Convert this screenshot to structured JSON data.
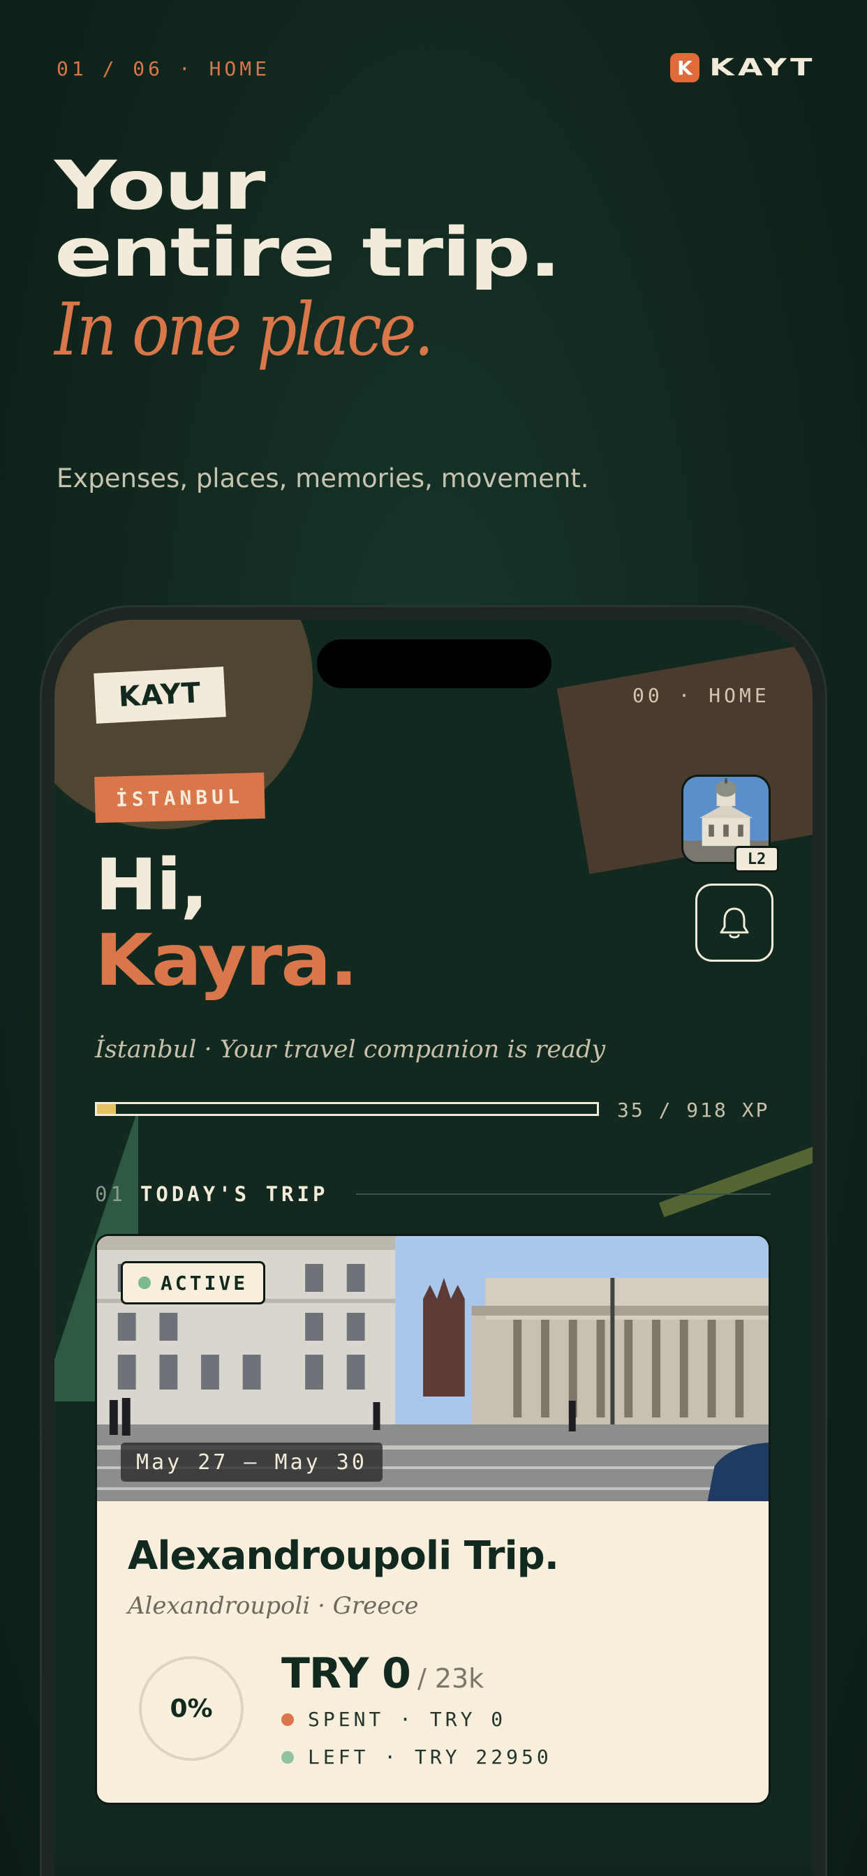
{
  "page": {
    "breadcrumb": "01 / 06 · HOME",
    "brand": {
      "mark": "K",
      "name": "KAYT"
    },
    "hero": {
      "line1": "Your",
      "line2": "entire trip.",
      "line3": "In one place."
    },
    "tagline": "Expenses, places, memories, movement."
  },
  "app": {
    "logo": "KAYT",
    "breadcrumb": "00 · HOME",
    "city_tag": "İSTANBUL",
    "avatar": {
      "icon": "landmark-photo",
      "level": "L2"
    },
    "bell_icon": "bell-icon",
    "greeting": {
      "hi": "Hi,",
      "name": "Kayra."
    },
    "subtitle": "İstanbul · Your travel companion is ready",
    "xp": {
      "current": 35,
      "max": 918,
      "label": "35 / 918 XP"
    },
    "section": {
      "number": "01",
      "title": "TODAY'S TRIP"
    },
    "trip": {
      "status": "ACTIVE",
      "dates": "May 27 — May 30",
      "title": "Alexandroupoli Trip.",
      "location": "Alexandroupoli · Greece",
      "progress": "0%",
      "budget_spent": "TRY 0",
      "budget_total": "/ 23k",
      "spent_label": "SPENT · TRY 0",
      "left_label": "LEFT · TRY 22950"
    }
  },
  "colors": {
    "background": "#12291f",
    "accent": "#d9764a",
    "cream": "#f3ebd9",
    "xp_fill": "#e4c163",
    "active": "#7cb98c"
  }
}
